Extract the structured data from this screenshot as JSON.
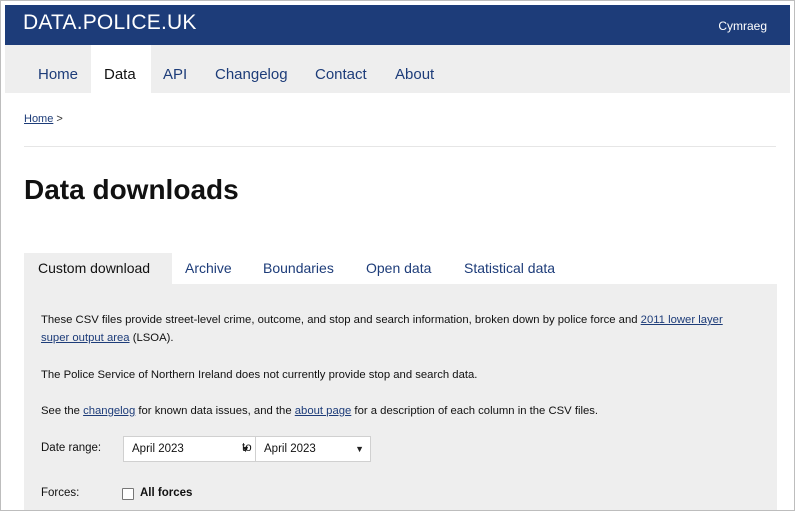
{
  "header": {
    "logo": "DATA.POLICE.UK",
    "language_link": "Cymraeg"
  },
  "nav": {
    "items": [
      {
        "label": "Home"
      },
      {
        "label": "Data",
        "active": true
      },
      {
        "label": "API"
      },
      {
        "label": "Changelog"
      },
      {
        "label": "Contact"
      },
      {
        "label": "About"
      }
    ]
  },
  "breadcrumb": {
    "home": "Home",
    "separator": ">"
  },
  "page": {
    "title": "Data downloads"
  },
  "tabs": [
    {
      "label": "Custom download",
      "active": true
    },
    {
      "label": "Archive"
    },
    {
      "label": "Boundaries"
    },
    {
      "label": "Open data"
    },
    {
      "label": "Statistical data"
    }
  ],
  "content": {
    "intro_part1": "These CSV files provide street-level crime, outcome, and stop and search information, broken down by police force and ",
    "intro_link": "2011 lower layer super output area",
    "intro_part2": " (LSOA).",
    "psni_note": "The Police Service of Northern Ireland does not currently provide stop and search data.",
    "see_prefix": "See the ",
    "changelog_link": "changelog",
    "see_middle": " for known data issues, and the ",
    "about_link": "about page",
    "see_suffix": " for a description of each column in the CSV files."
  },
  "form": {
    "date_range_label": "Date range:",
    "from_value": "April 2023",
    "to_label": "to",
    "to_value": "April 2023",
    "forces_label": "Forces:",
    "all_forces_label": "All forces",
    "all_forces_checked": false
  },
  "icons": {
    "dropdown": "chevron-down-icon",
    "checkbox": "checkbox-unchecked"
  },
  "colors": {
    "brand_blue": "#1d3c79",
    "nav_background": "#eeeeee",
    "panel_background": "#eeeeee"
  }
}
